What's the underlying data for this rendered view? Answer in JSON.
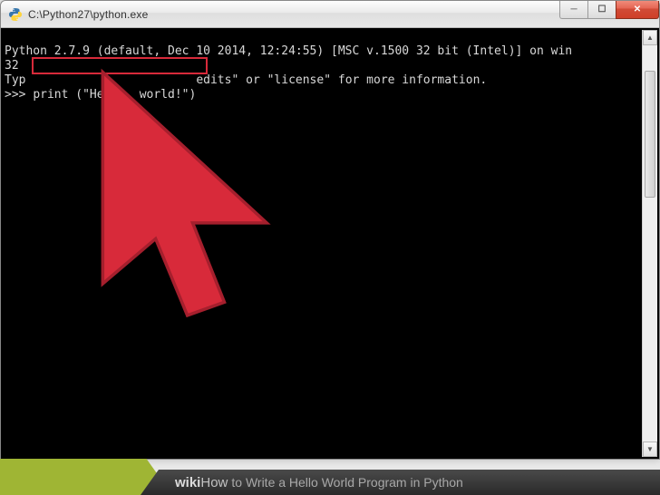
{
  "window": {
    "title": "C:\\Python27\\python.exe"
  },
  "console": {
    "line1": "Python 2.7.9 (default, Dec 10 2014, 12:24:55) [MSC v.1500 32 bit (Intel)] on win",
    "line2": "32",
    "line3_a": "Typ",
    "line3_b": "edits\" or \"license\" for more information.",
    "prompt": ">>> ",
    "command": "print (\"Hello, world!\")"
  },
  "banner": {
    "wiki": "wiki",
    "how": "How",
    "title": " to Write a Hello World Program in Python"
  },
  "icons": {
    "minimize": "─",
    "maximize": "☐",
    "close": "✕",
    "up": "▲",
    "down": "▼"
  }
}
